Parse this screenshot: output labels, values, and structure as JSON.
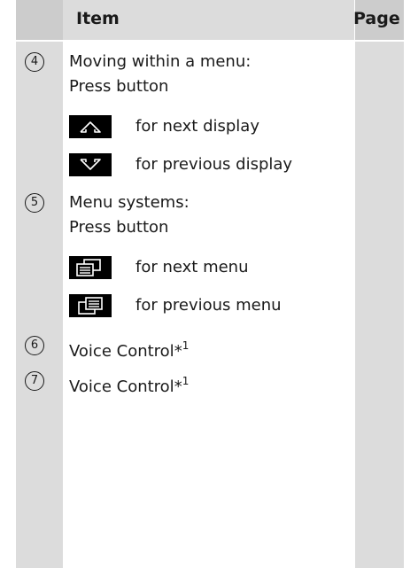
{
  "header": {
    "item_label": "Item",
    "page_label": "Page"
  },
  "rows": [
    {
      "number": "4",
      "text_line1": "Moving within a menu:",
      "text_line2": "Press button",
      "subitems": [
        {
          "icon": "arrow-up-icon",
          "label": "for next display"
        },
        {
          "icon": "arrow-down-icon",
          "label": "for previous display"
        }
      ]
    },
    {
      "number": "5",
      "text_line1": "Menu systems:",
      "text_line2": "Press button",
      "subitems": [
        {
          "icon": "next-menu-icon",
          "label": "for next menu"
        },
        {
          "icon": "previous-menu-icon",
          "label": "for previous menu"
        }
      ]
    },
    {
      "number": "6",
      "text": "Voice Control",
      "mark": "*",
      "footnote": "1"
    },
    {
      "number": "7",
      "text": "Voice Control",
      "mark": "*",
      "footnote": "1"
    }
  ]
}
